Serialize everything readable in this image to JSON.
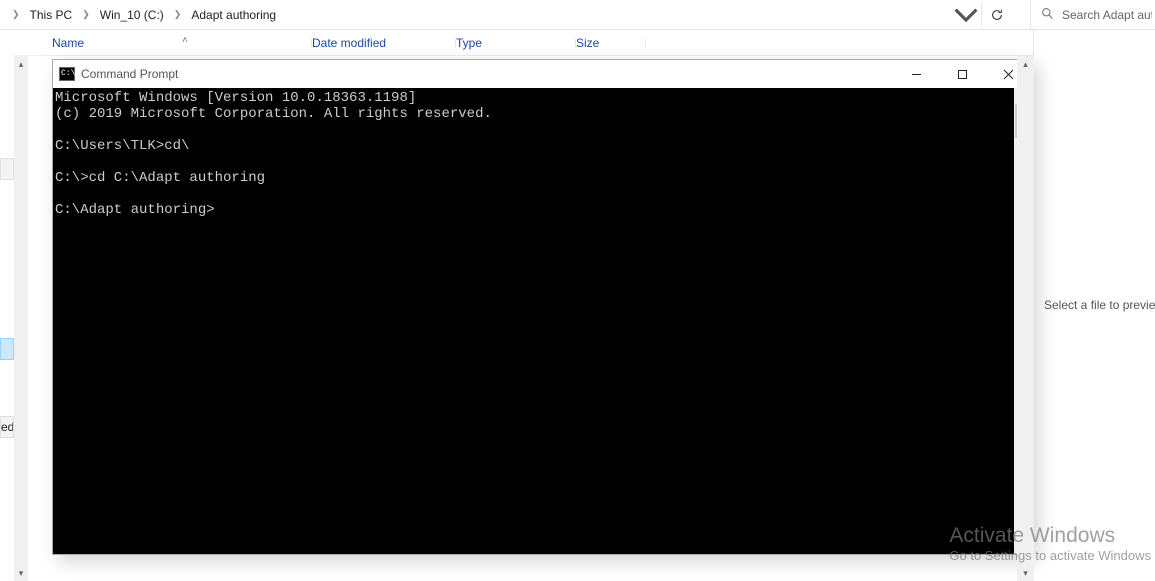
{
  "breadcrumb": {
    "items": [
      "This PC",
      "Win_10 (C:)",
      "Adapt authoring"
    ]
  },
  "search": {
    "placeholder": "Search Adapt aut"
  },
  "columns": {
    "name": "Name",
    "date": "Date modified",
    "type": "Type",
    "size": "Size"
  },
  "treeFragment": {
    "label": "ed"
  },
  "preview": {
    "text": "Select a file to preview"
  },
  "cmd": {
    "title": "Command Prompt",
    "iconText": "C:\\",
    "lines": [
      "Microsoft Windows [Version 10.0.18363.1198]",
      "(c) 2019 Microsoft Corporation. All rights reserved.",
      "",
      "C:\\Users\\TLK>cd\\",
      "",
      "C:\\>cd C:\\Adapt authoring",
      "",
      "C:\\Adapt authoring>"
    ]
  },
  "watermark": {
    "line1": "Activate Windows",
    "line2": "Go to Settings to activate Windows"
  }
}
